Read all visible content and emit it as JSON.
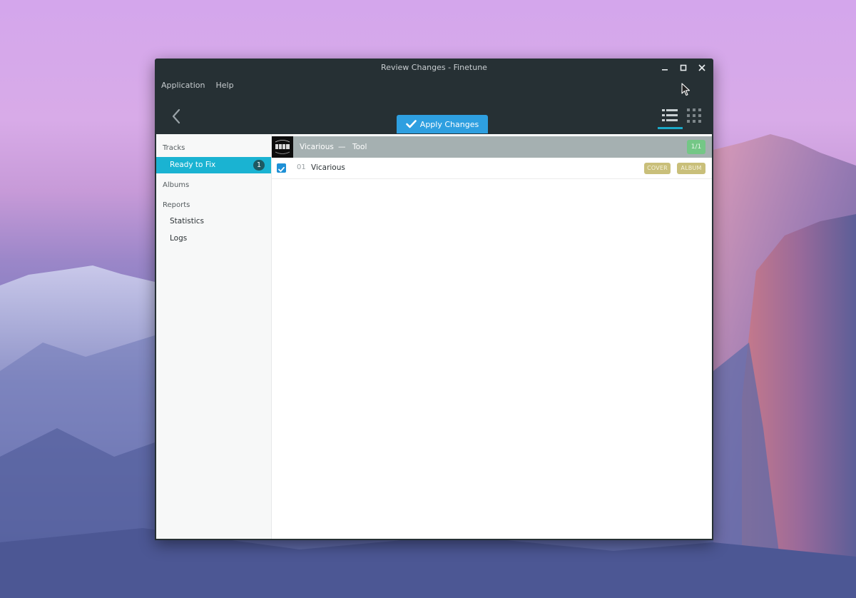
{
  "window": {
    "title": "Review Changes - Finetune"
  },
  "menubar": {
    "items": [
      "Application",
      "Help"
    ]
  },
  "toolbar": {
    "apply_label": "Apply Changes"
  },
  "sidebar": {
    "tracks_heading": "Tracks",
    "ready_to_fix_label": "Ready to Fix",
    "ready_to_fix_count": "1",
    "albums_heading": "Albums",
    "reports_heading": "Reports",
    "statistics_label": "Statistics",
    "logs_label": "Logs"
  },
  "album": {
    "title": "Vicarious",
    "separator": "—",
    "artist": "Tool",
    "count": "1/1"
  },
  "tracks": [
    {
      "number": "01",
      "title": "Vicarious",
      "checked": true,
      "tags": [
        "COVER",
        "ALBUM"
      ]
    }
  ],
  "icons": {
    "minimize": "minimize-icon",
    "maximize": "maximize-icon",
    "close": "close-icon",
    "back": "back-arrow-icon",
    "apply": "checkmark-icon",
    "list_view": "list-view-icon",
    "grid_view": "grid-view-icon"
  },
  "colors": {
    "window_bg": "#263034",
    "accent": "#1ab3d2",
    "apply_button": "#2e9fe0",
    "album_header": "#a5b0b1",
    "count_badge": "#74c786",
    "tag": "#c9bf7a"
  }
}
